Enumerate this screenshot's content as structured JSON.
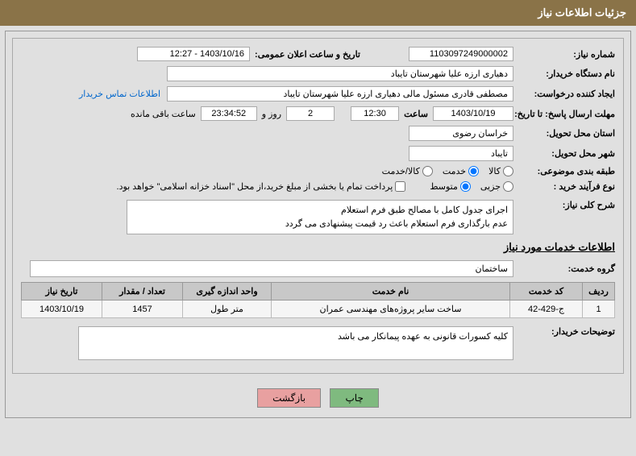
{
  "header": {
    "title": "جزئیات اطلاعات نیاز"
  },
  "fields": {
    "need_no_label": "شماره نیاز:",
    "need_no": "1103097249000002",
    "ann_label": "تاریخ و ساعت اعلان عمومی:",
    "ann_value": "1403/10/16 - 12:27",
    "buyer_org_label": "نام دستگاه خریدار:",
    "buyer_org": "دهیاری ارزه علیا  شهرستان تایباد",
    "requester_label": "ایجاد کننده درخواست:",
    "requester": "مصطفی قادری مسئول مالی دهیاری ارزه علیا  شهرستان تایباد",
    "contact_link": "اطلاعات تماس خریدار",
    "deadline_label": "مهلت ارسال پاسخ: تا تاریخ:",
    "deadline_date": "1403/10/19",
    "time_label": "ساعت",
    "deadline_time": "12:30",
    "days_remain": "2",
    "days_remain_suffix": "روز و",
    "countdown": "23:34:52",
    "countdown_suffix": "ساعت باقی مانده",
    "province_label": "استان محل تحویل:",
    "province": "خراسان رضوی",
    "city_label": "شهر محل تحویل:",
    "city": "تایباد",
    "subject_label": "طبقه بندی موضوعی:",
    "radio_kala": "کالا",
    "radio_khedmat": "خدمت",
    "radio_kalakhedmat": "کالا/خدمت",
    "proc_type_label": "نوع فرآیند خرید :",
    "radio_jozei": "جزیی",
    "radio_motavaset": "متوسط",
    "check_payment": "پرداخت تمام یا بخشی از مبلغ خرید،از محل \"اسناد خزانه اسلامی\" خواهد بود.",
    "summary_label": "شرح کلی نیاز:",
    "summary_line1": "اجرای جدول کامل با مصالح  طبق فرم استعلام",
    "summary_line2": "عدم بارگذاری فرم استعلام باعث رد قیمت پیشنهادی می گردد",
    "services_title": "اطلاعات خدمات مورد نیاز",
    "group_label": "گروه خدمت:",
    "group_value": "ساختمان",
    "note_label": "توضیحات خریدار:",
    "note_value": "کلیه کسورات قانونی به عهده پیمانکار می باشد"
  },
  "table": {
    "headers": {
      "row": "ردیف",
      "code": "کد خدمت",
      "name": "نام خدمت",
      "unit": "واحد اندازه گیری",
      "qty": "تعداد / مقدار",
      "date": "تاریخ نیاز"
    },
    "rows": [
      {
        "row": "1",
        "code": "ج-429-42",
        "name": "ساخت سایر پروژه‌های مهندسی عمران",
        "unit": "متر طول",
        "qty": "1457",
        "date": "1403/10/19"
      }
    ]
  },
  "buttons": {
    "print": "چاپ",
    "back": "بازگشت"
  }
}
